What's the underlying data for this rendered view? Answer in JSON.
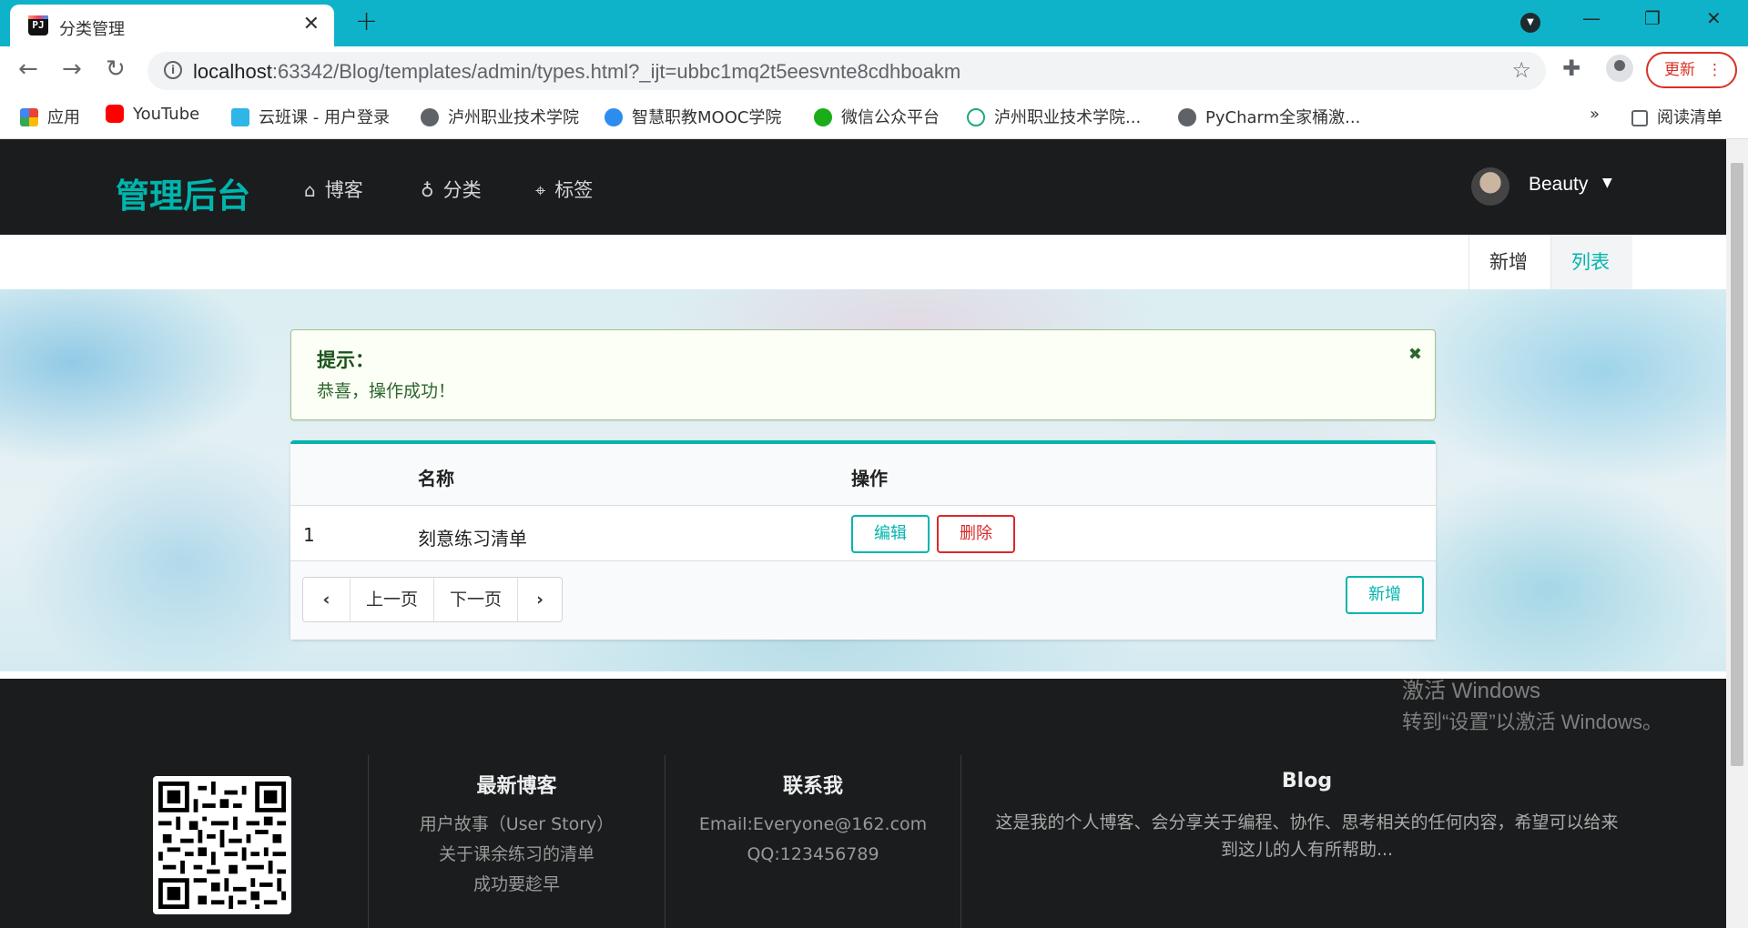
{
  "browser": {
    "tab_title": "分类管理",
    "favicon_text": "PJ",
    "url_host": "localhost",
    "url_rest": ":63342/Blog/templates/admin/types.html?_ijt=ubbc1mq2t5eesvnte8cdhboakm",
    "update_label": "更新",
    "bookmarks": [
      {
        "label": "应用",
        "color": "#4285f4"
      },
      {
        "label": "YouTube",
        "color": "#ff0000"
      },
      {
        "label": "云班课 - 用户登录",
        "color": "#2fb5e6"
      },
      {
        "label": "泸州职业技术学院",
        "color": "#5f6368"
      },
      {
        "label": "智慧职教MOOC学院",
        "color": "#2d8cf0"
      },
      {
        "label": "微信公众平台",
        "color": "#1aad19"
      },
      {
        "label": "泸州职业技术学院...",
        "color": "#1aad7a"
      },
      {
        "label": "PyCharm全家桶激...",
        "color": "#5f6368"
      }
    ],
    "bookmarks_overflow": "»",
    "reading_list": "阅读清单"
  },
  "nav": {
    "brand": "管理后台",
    "items": [
      {
        "icon": "home-icon",
        "label": "博客"
      },
      {
        "icon": "bulb-icon",
        "label": "分类"
      },
      {
        "icon": "tags-icon",
        "label": "标签"
      }
    ],
    "user": "Beauty"
  },
  "subnav": {
    "new": "新增",
    "list": "列表"
  },
  "alert": {
    "title": "提示：",
    "message": "恭喜，操作成功！"
  },
  "table": {
    "headers": [
      "",
      "名称",
      "操作"
    ],
    "rows": [
      {
        "id": "1",
        "name": "刻意练习清单"
      }
    ],
    "edit_label": "编辑",
    "delete_label": "删除",
    "prev_page": "上一页",
    "next_page": "下一页",
    "add_label": "新增"
  },
  "footer": {
    "latest_title": "最新博客",
    "latest_items": [
      "用户故事（User Story）",
      "关于课余练习的清单",
      "成功要趁早"
    ],
    "contact_title": "联系我",
    "contact_items": [
      "Email:Everyone@162.com",
      "QQ:123456789"
    ],
    "blog_title": "Blog",
    "blog_desc": "这是我的个人博客、会分享关于编程、协作、思考相关的任何内容，希望可以给来到这儿的人有所帮助..."
  },
  "watermark": {
    "line1": "激活 Windows",
    "line2": "转到“设置”以激活 Windows。"
  }
}
